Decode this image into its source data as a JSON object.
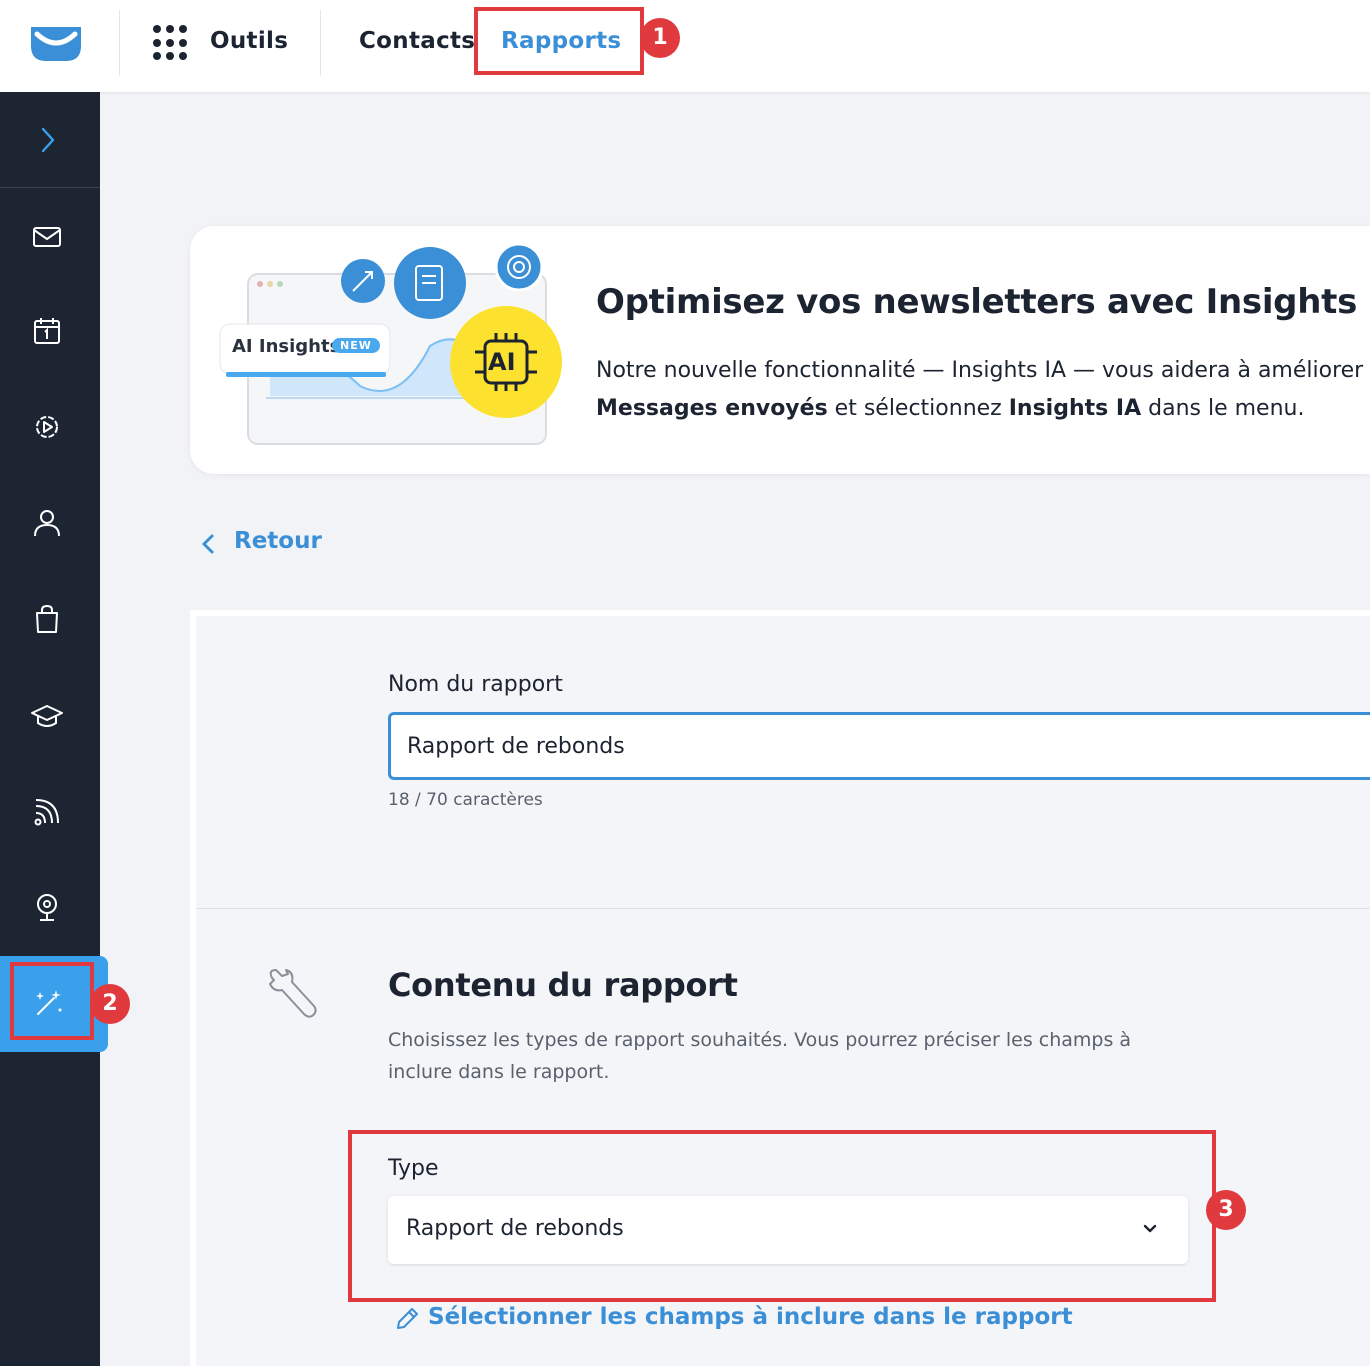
{
  "topnav": {
    "tools_label": "Outils",
    "contacts_label": "Contacts",
    "reports_label": "Rapports"
  },
  "markers": [
    "1",
    "2",
    "3"
  ],
  "banner": {
    "ai_badge_label": "AI Insights",
    "ai_badge_new": "NEW",
    "ai_chip": "AI",
    "title": "Optimisez vos newsletters avec Insights IA",
    "body_line1": "Notre nouvelle fonctionnalité — Insights IA — vous aidera à améliorer",
    "body_line2_bold1": "Messages envoyés",
    "body_line2_mid": " et sélectionnez ",
    "body_line2_bold2": "Insights IA",
    "body_line2_end": " dans le menu."
  },
  "back": {
    "label": "Retour"
  },
  "form": {
    "name_label": "Nom du rapport",
    "name_value": "Rapport de rebonds",
    "counter": "18 / 70 caractères",
    "section_title": "Contenu du rapport",
    "section_desc": "Choisissez les types de rapport souhaités. Vous pourrez préciser les champs à inclure dans le rapport.",
    "type_label": "Type",
    "type_value": "Rapport de rebonds",
    "fields_link": "Sélectionner les champs à inclure dans le rapport"
  },
  "colors": {
    "accent": "#3a8fd6",
    "sidebar_bg": "#1d2533",
    "sidebar_active": "#3aa0ec",
    "highlight": "#e0393e"
  }
}
